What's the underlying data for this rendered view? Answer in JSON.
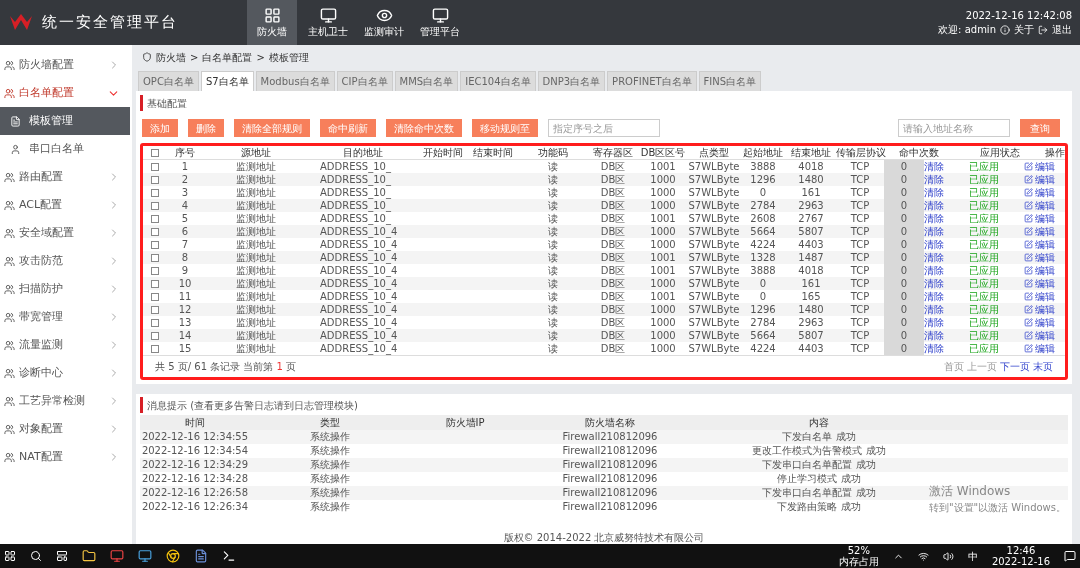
{
  "app": {
    "title": "统一安全管理平台"
  },
  "nav": [
    {
      "label": "防火墙",
      "selected": true
    },
    {
      "label": "主机卫士",
      "selected": false
    },
    {
      "label": "监测审计",
      "selected": false
    },
    {
      "label": "管理平台",
      "selected": false
    }
  ],
  "user_bar": {
    "datetime": "2022-12-16 12:42:08",
    "welcome": "欢迎: admin",
    "about": "关于",
    "logout": "退出"
  },
  "sidebar": {
    "items": [
      {
        "label": "防火墙配置",
        "expanded": false,
        "selected": false
      },
      {
        "label": "白名单配置",
        "expanded": true,
        "selected": false,
        "children": [
          {
            "label": "模板管理",
            "selected": true
          },
          {
            "label": "串口白名单",
            "selected": false
          }
        ]
      },
      {
        "label": "路由配置",
        "expanded": false,
        "selected": false
      },
      {
        "label": "ACL配置",
        "expanded": false,
        "selected": false
      },
      {
        "label": "安全域配置",
        "expanded": false,
        "selected": false
      },
      {
        "label": "攻击防范",
        "expanded": false,
        "selected": false
      },
      {
        "label": "扫描防护",
        "expanded": false,
        "selected": false
      },
      {
        "label": "带宽管理",
        "expanded": false,
        "selected": false
      },
      {
        "label": "流量监测",
        "expanded": false,
        "selected": false
      },
      {
        "label": "诊断中心",
        "expanded": false,
        "selected": false
      },
      {
        "label": "工艺异常检测",
        "expanded": false,
        "selected": false
      },
      {
        "label": "对象配置",
        "expanded": false,
        "selected": false
      },
      {
        "label": "NAT配置",
        "expanded": false,
        "selected": false
      }
    ]
  },
  "breadcrumb": [
    "防火墙",
    "白名单配置",
    "模板管理"
  ],
  "breadcrumb_separator": ">",
  "tabs": [
    {
      "label": "OPC白名单",
      "selected": false
    },
    {
      "label": "S7白名单",
      "selected": true
    },
    {
      "label": "Modbus白名单",
      "selected": false
    },
    {
      "label": "CIP白名单",
      "selected": false
    },
    {
      "label": "MMS白名单",
      "selected": false
    },
    {
      "label": "IEC104白名单",
      "selected": false
    },
    {
      "label": "DNP3白名单",
      "selected": false
    },
    {
      "label": "PROFINET白名单",
      "selected": false
    },
    {
      "label": "FINS白名单",
      "selected": false
    }
  ],
  "section_title": "基础配置",
  "toolbar": {
    "buttons": [
      "添加",
      "删除",
      "清除全部规则",
      "命中刷新",
      "清除命中次数",
      "移动规则至"
    ],
    "position_placeholder": "指定序号之后",
    "search_placeholder": "请输入地址名称",
    "search_button": "查询"
  },
  "table": {
    "all_checked": false,
    "columns": [
      "序号",
      "源地址",
      "目的地址",
      "开始时间",
      "结束时间",
      "功能码",
      "寄存器区",
      "DB区区号",
      "点类型",
      "起始地址",
      "结束地址",
      "传输层协议",
      "命中次数",
      "应用状态",
      "操作"
    ],
    "rows": [
      {
        "checked": false,
        "no": "1",
        "src": "监测地址",
        "dst": "ADDRESS_10_",
        "func": "读",
        "area": "DB区",
        "db": "1001",
        "type": "S7WLByte",
        "start": "3888",
        "end": "4018",
        "proto": "TCP",
        "hits": "0",
        "clear": "清除",
        "status": "已应用",
        "action": "编辑"
      },
      {
        "checked": false,
        "no": "2",
        "src": "监测地址",
        "dst": "ADDRESS_10_",
        "func": "读",
        "area": "DB区",
        "db": "1000",
        "type": "S7WLByte",
        "start": "1296",
        "end": "1480",
        "proto": "TCP",
        "hits": "0",
        "clear": "清除",
        "status": "已应用",
        "action": "编辑"
      },
      {
        "checked": false,
        "no": "3",
        "src": "监测地址",
        "dst": "ADDRESS_10_",
        "func": "读",
        "area": "DB区",
        "db": "1000",
        "type": "S7WLByte",
        "start": "0",
        "end": "161",
        "proto": "TCP",
        "hits": "0",
        "clear": "清除",
        "status": "已应用",
        "action": "编辑"
      },
      {
        "checked": false,
        "no": "4",
        "src": "监测地址",
        "dst": "ADDRESS_10_",
        "func": "读",
        "area": "DB区",
        "db": "1000",
        "type": "S7WLByte",
        "start": "2784",
        "end": "2963",
        "proto": "TCP",
        "hits": "0",
        "clear": "清除",
        "status": "已应用",
        "action": "编辑"
      },
      {
        "checked": false,
        "no": "5",
        "src": "监测地址",
        "dst": "ADDRESS_10_",
        "func": "读",
        "area": "DB区",
        "db": "1001",
        "type": "S7WLByte",
        "start": "2608",
        "end": "2767",
        "proto": "TCP",
        "hits": "0",
        "clear": "清除",
        "status": "已应用",
        "action": "编辑"
      },
      {
        "checked": false,
        "no": "6",
        "src": "监测地址",
        "dst": "ADDRESS_10_4",
        "func": "读",
        "area": "DB区",
        "db": "1000",
        "type": "S7WLByte",
        "start": "5664",
        "end": "5807",
        "proto": "TCP",
        "hits": "0",
        "clear": "清除",
        "status": "已应用",
        "action": "编辑"
      },
      {
        "checked": false,
        "no": "7",
        "src": "监测地址",
        "dst": "ADDRESS_10_4",
        "func": "读",
        "area": "DB区",
        "db": "1000",
        "type": "S7WLByte",
        "start": "4224",
        "end": "4403",
        "proto": "TCP",
        "hits": "0",
        "clear": "清除",
        "status": "已应用",
        "action": "编辑"
      },
      {
        "checked": false,
        "no": "8",
        "src": "监测地址",
        "dst": "ADDRESS_10_4",
        "func": "读",
        "area": "DB区",
        "db": "1001",
        "type": "S7WLByte",
        "start": "1328",
        "end": "1487",
        "proto": "TCP",
        "hits": "0",
        "clear": "清除",
        "status": "已应用",
        "action": "编辑"
      },
      {
        "checked": false,
        "no": "9",
        "src": "监测地址",
        "dst": "ADDRESS_10_4",
        "func": "读",
        "area": "DB区",
        "db": "1001",
        "type": "S7WLByte",
        "start": "3888",
        "end": "4018",
        "proto": "TCP",
        "hits": "0",
        "clear": "清除",
        "status": "已应用",
        "action": "编辑"
      },
      {
        "checked": false,
        "no": "10",
        "src": "监测地址",
        "dst": "ADDRESS_10_4",
        "func": "读",
        "area": "DB区",
        "db": "1000",
        "type": "S7WLByte",
        "start": "0",
        "end": "161",
        "proto": "TCP",
        "hits": "0",
        "clear": "清除",
        "status": "已应用",
        "action": "编辑"
      },
      {
        "checked": false,
        "no": "11",
        "src": "监测地址",
        "dst": "ADDRESS_10_4",
        "func": "读",
        "area": "DB区",
        "db": "1001",
        "type": "S7WLByte",
        "start": "0",
        "end": "165",
        "proto": "TCP",
        "hits": "0",
        "clear": "清除",
        "status": "已应用",
        "action": "编辑"
      },
      {
        "checked": false,
        "no": "12",
        "src": "监测地址",
        "dst": "ADDRESS_10_4",
        "func": "读",
        "area": "DB区",
        "db": "1000",
        "type": "S7WLByte",
        "start": "1296",
        "end": "1480",
        "proto": "TCP",
        "hits": "0",
        "clear": "清除",
        "status": "已应用",
        "action": "编辑"
      },
      {
        "checked": false,
        "no": "13",
        "src": "监测地址",
        "dst": "ADDRESS_10_4",
        "func": "读",
        "area": "DB区",
        "db": "1000",
        "type": "S7WLByte",
        "start": "2784",
        "end": "2963",
        "proto": "TCP",
        "hits": "0",
        "clear": "清除",
        "status": "已应用",
        "action": "编辑"
      },
      {
        "checked": false,
        "no": "14",
        "src": "监测地址",
        "dst": "ADDRESS_10_4",
        "func": "读",
        "area": "DB区",
        "db": "1000",
        "type": "S7WLByte",
        "start": "5664",
        "end": "5807",
        "proto": "TCP",
        "hits": "0",
        "clear": "清除",
        "status": "已应用",
        "action": "编辑"
      },
      {
        "checked": false,
        "no": "15",
        "src": "监测地址",
        "dst": "ADDRESS_10_4",
        "func": "读",
        "area": "DB区",
        "db": "1000",
        "type": "S7WLByte",
        "start": "4224",
        "end": "4403",
        "proto": "TCP",
        "hits": "0",
        "clear": "清除",
        "status": "已应用",
        "action": "编辑"
      }
    ]
  },
  "pagination": {
    "summary_before": "共 5 页/ 61 条记录 当前第",
    "current": "1",
    "summary_after": "页",
    "links": [
      "首页",
      "上一页",
      "下一页",
      "末页"
    ]
  },
  "messages": {
    "title": "消息提示 (查看更多告警日志请到日志管理模块)",
    "columns": [
      "时间",
      "类型",
      "防火墙IP",
      "防火墙名称",
      "内容"
    ],
    "rows": [
      {
        "time": "2022-12-16 12:34:55",
        "type": "系统操作",
        "name": "Firewall210812096",
        "content": "下发白名单 成功"
      },
      {
        "time": "2022-12-16 12:34:54",
        "type": "系统操作",
        "name": "Firewall210812096",
        "content": "更改工作模式为告警模式 成功"
      },
      {
        "time": "2022-12-16 12:34:29",
        "type": "系统操作",
        "name": "Firewall210812096",
        "content": "下发串口白名单配置 成功"
      },
      {
        "time": "2022-12-16 12:34:28",
        "type": "系统操作",
        "name": "Firewall210812096",
        "content": "停止学习模式 成功"
      },
      {
        "time": "2022-12-16 12:26:58",
        "type": "系统操作",
        "name": "Firewall210812096",
        "content": "下发串口白名单配置 成功"
      },
      {
        "time": "2022-12-16 12:26:34",
        "type": "系统操作",
        "name": "Firewall210812096",
        "content": "下发路由策略 成功"
      }
    ]
  },
  "copyright": "版权© 2014-2022 北京威努特技术有限公司",
  "activation": {
    "title": "激活 Windows",
    "hint": "转到\"设置\"以激活 Windows。"
  },
  "taskbar": {
    "memory": "52%",
    "memory_label": "内存占用",
    "ime": "中",
    "time": "12:46",
    "date": "2022-12-16"
  }
}
